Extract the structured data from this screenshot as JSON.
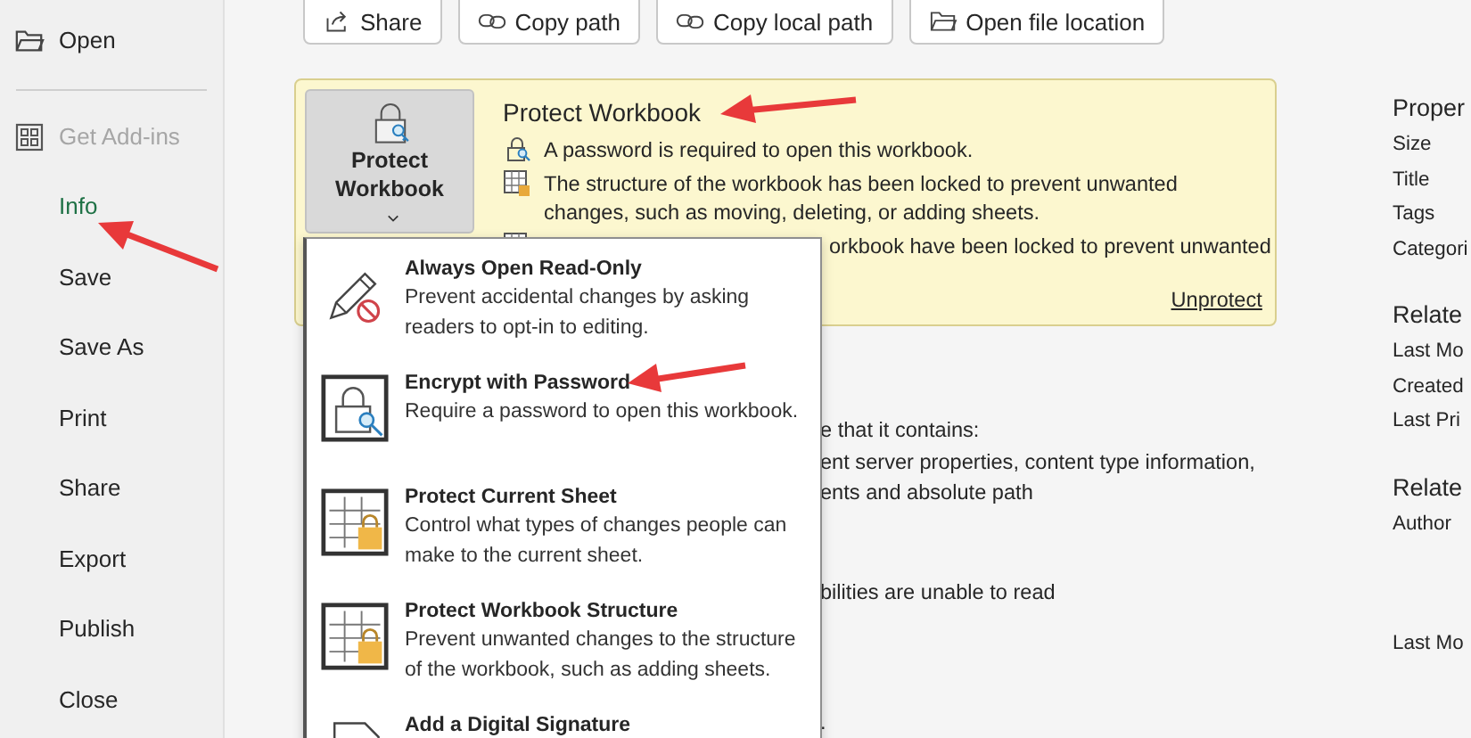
{
  "sidebar": {
    "items": [
      {
        "label": "Open",
        "kind": "folder",
        "selected": false,
        "disabled": false
      },
      {
        "kind": "separator"
      },
      {
        "label": "Get Add-ins",
        "kind": "addins",
        "selected": false,
        "disabled": true
      },
      {
        "label": "Info",
        "kind": "plain",
        "selected": true,
        "disabled": false
      },
      {
        "label": "Save",
        "kind": "plain",
        "selected": false,
        "disabled": false
      },
      {
        "label": "Save As",
        "kind": "plain",
        "selected": false,
        "disabled": false
      },
      {
        "label": "Print",
        "kind": "plain",
        "selected": false,
        "disabled": false
      },
      {
        "label": "Share",
        "kind": "plain",
        "selected": false,
        "disabled": false
      },
      {
        "label": "Export",
        "kind": "plain",
        "selected": false,
        "disabled": false
      },
      {
        "label": "Publish",
        "kind": "plain",
        "selected": false,
        "disabled": false
      },
      {
        "label": "Close",
        "kind": "plain",
        "selected": false,
        "disabled": false
      }
    ]
  },
  "toolbar": [
    {
      "label": "Share",
      "kind": "share"
    },
    {
      "label": "Copy path",
      "kind": "link"
    },
    {
      "label": "Copy local path",
      "kind": "link"
    },
    {
      "label": "Open file location",
      "kind": "folder"
    }
  ],
  "protect_card": {
    "button_label": "Protect Workbook",
    "title": "Protect Workbook",
    "items": [
      {
        "kind": "key",
        "text": "A password is required to open this workbook."
      },
      {
        "kind": "sheet",
        "text": "The structure of the workbook has been locked to prevent unwanted changes, such as moving, deleting, or adding sheets."
      },
      {
        "kind": "sheet-partial",
        "text": "orkbook have been locked to prevent unwanted"
      }
    ],
    "link": "Unprotect"
  },
  "protect_menu": [
    {
      "kind": "pencil",
      "title": "Always Open Read-Only",
      "description": "Prevent accidental changes by asking readers to opt-in to editing."
    },
    {
      "kind": "lock",
      "title": "Encrypt with Password",
      "description": "Require a password to open this workbook."
    },
    {
      "kind": "sheet",
      "title": "Protect Current Sheet",
      "description": "Control what types of changes people can make to the current sheet."
    },
    {
      "kind": "sheet",
      "title": "Protect Workbook Structure",
      "description": "Prevent unwanted changes to the structure of the workbook, such as adding sheets."
    },
    {
      "kind": "signature",
      "title": "Add a Digital Signature"
    }
  ],
  "inspect_text": [
    [
      "e that it contains:",
      "ent server properties, content type information,",
      "ents and absolute path"
    ],
    [
      "bilities are unable to read"
    ],
    [
      "."
    ]
  ],
  "properties": [
    {
      "heading": "Proper",
      "rows": [
        "Size",
        "Title",
        "Tags",
        "Categori"
      ]
    },
    {
      "heading": "Relate",
      "rows": [
        "Last Mo",
        "Created",
        "Last Pri"
      ]
    },
    {
      "heading": "Relate",
      "rows": [
        "Author"
      ]
    },
    {
      "rows": [
        "Last Mo"
      ]
    }
  ]
}
